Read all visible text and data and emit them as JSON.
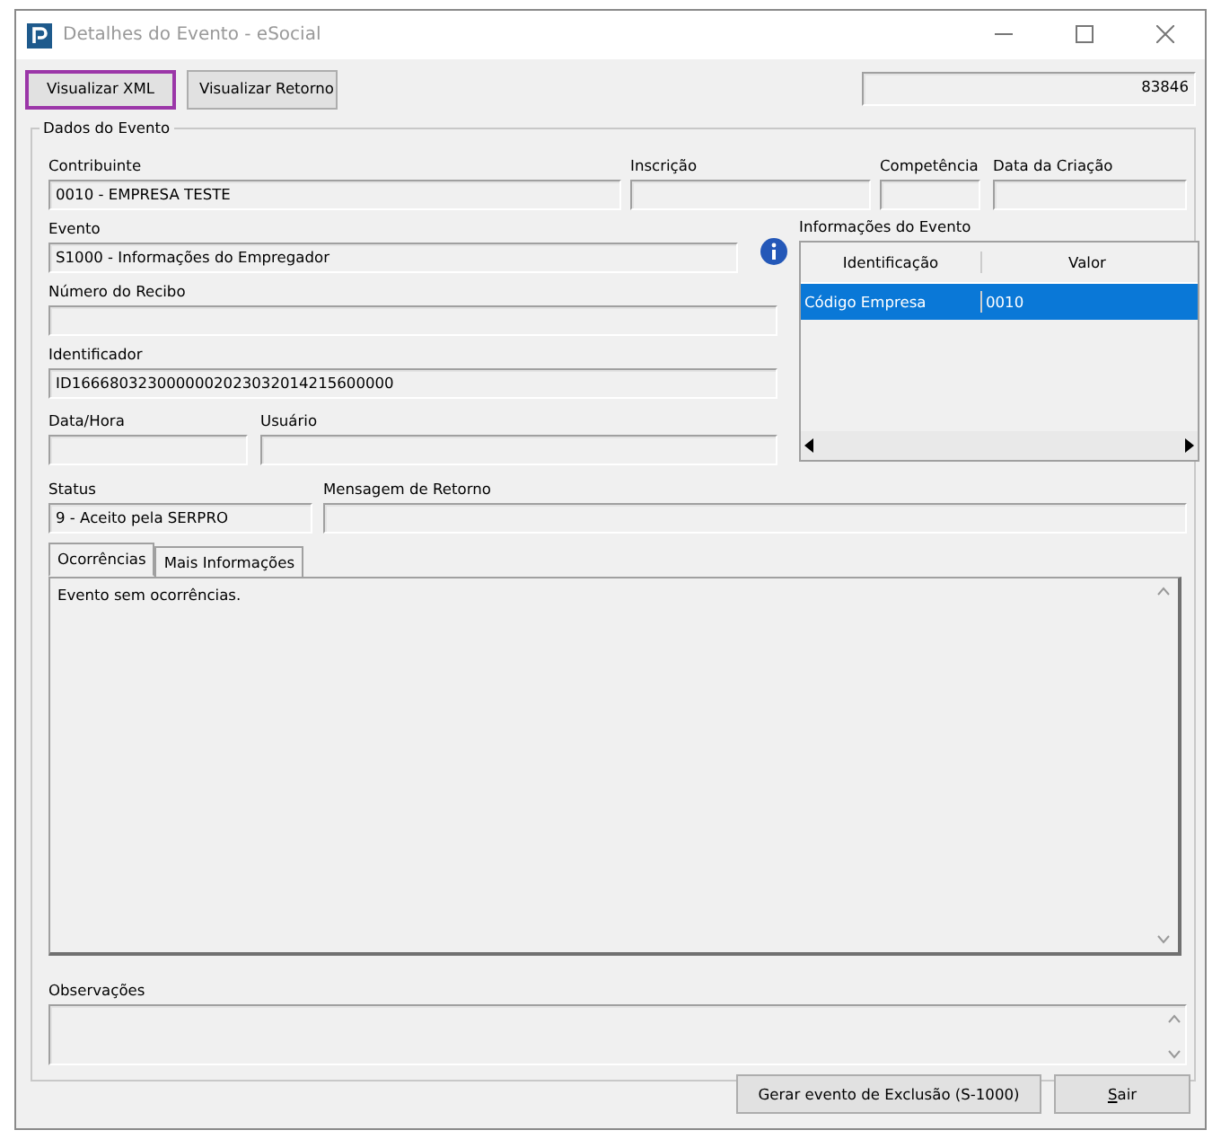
{
  "window": {
    "title": "Detalhes do Evento - eSocial"
  },
  "toolbar": {
    "buttons": [
      {
        "label": "Visualizar XML",
        "focused": true
      },
      {
        "label": "Visualizar Retorno",
        "focused": false
      }
    ],
    "number": "83846"
  },
  "group": {
    "title": "Dados do Evento",
    "contribuinte": {
      "label": "Contribuinte",
      "value": "0010 - EMPRESA TESTE"
    },
    "inscricao": {
      "label": "Inscrição"
    },
    "competencia": {
      "label": "Competência"
    },
    "data_criacao": {
      "label": "Data da Criação"
    },
    "evento": {
      "label": "Evento",
      "value": "S1000 - Informações do Empregador"
    },
    "numero_recibo": {
      "label": "Número do Recibo"
    },
    "identificador": {
      "label": "Identificador",
      "value": "ID1666803230000002023032014215600000"
    },
    "data_hora": {
      "label": "Data/Hora"
    },
    "usuario": {
      "label": "Usuário"
    },
    "info_table": {
      "title": "Informações do Evento",
      "columns": [
        "Identificação",
        "Valor"
      ],
      "rows": [
        {
          "cells": [
            "Código Empresa",
            "0010"
          ],
          "selected": true
        }
      ]
    },
    "status": {
      "label": "Status",
      "value": "9 - Aceito pela SERPRO"
    },
    "mensagem": {
      "label": "Mensagem de Retorno"
    },
    "tabs": [
      {
        "label": "Ocorrências",
        "selected": true
      },
      {
        "label": "Mais Informações",
        "selected": false
      }
    ],
    "tab_content": "Evento sem ocorrências.",
    "observacoes": {
      "label": "Observações"
    }
  },
  "buttons": [
    {
      "label": "Gerar evento de Exclusão (S-1000)",
      "mnemonic": false
    },
    {
      "label": "Sair",
      "mnemonic": true
    }
  ]
}
